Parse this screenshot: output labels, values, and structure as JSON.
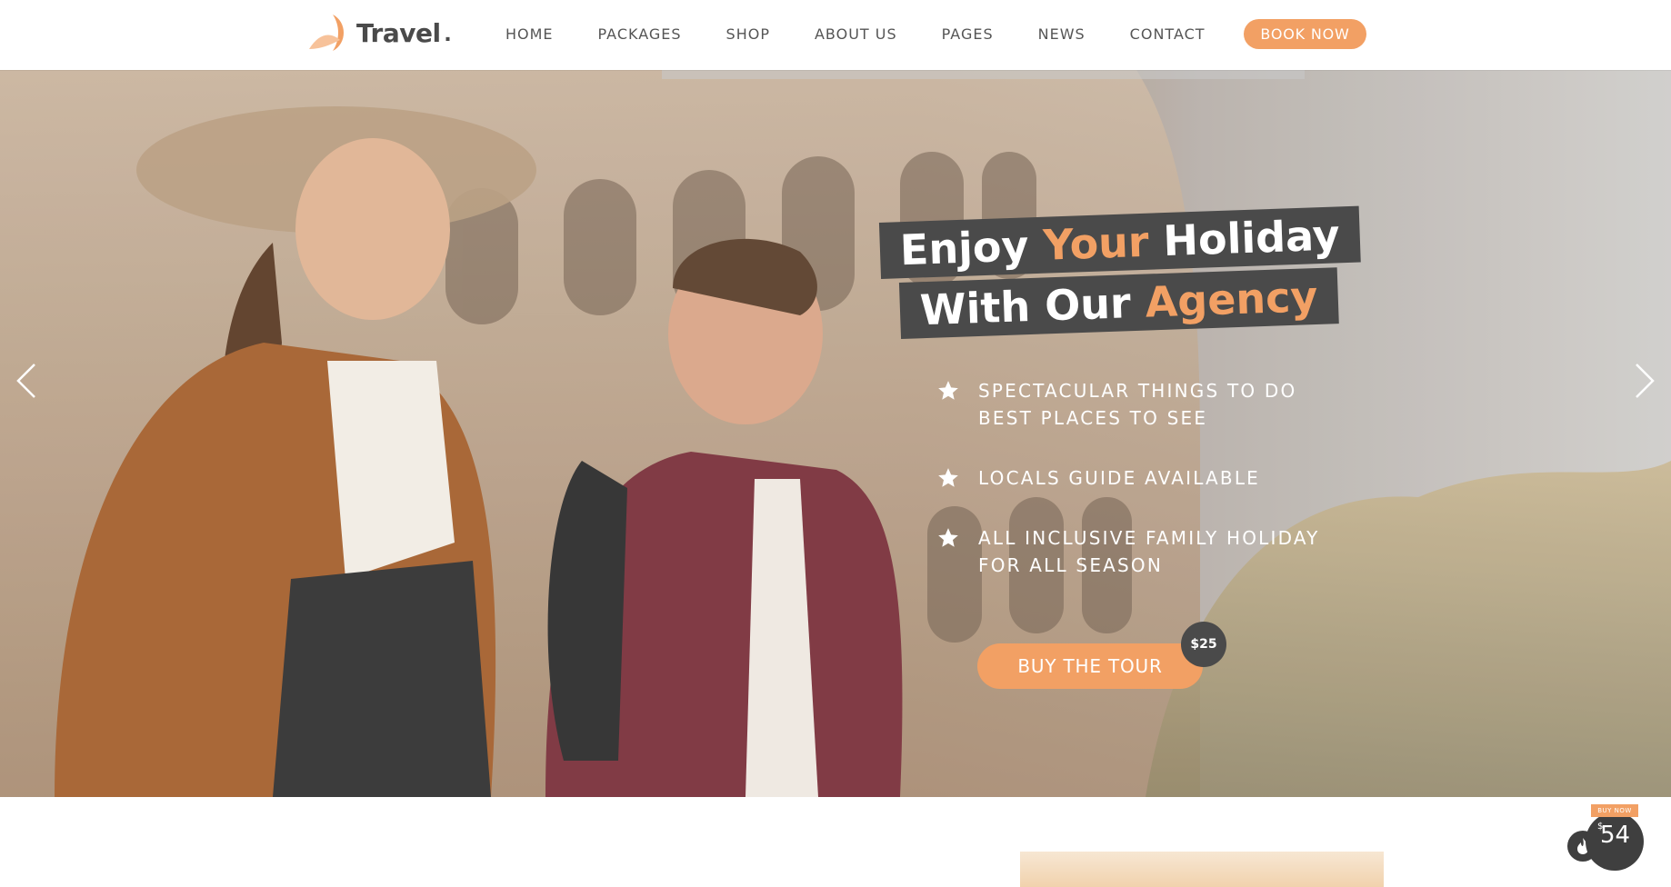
{
  "brand": {
    "name": "Travel",
    "dot": ".",
    "accent": "#f2a064",
    "dark": "#4a4a4a"
  },
  "nav": {
    "items": [
      {
        "label": "HOME"
      },
      {
        "label": "PACKAGES"
      },
      {
        "label": "SHOP"
      },
      {
        "label": "ABOUT US"
      },
      {
        "label": "PAGES"
      },
      {
        "label": "NEWS"
      },
      {
        "label": "CONTACT"
      }
    ],
    "cta": "BOOK NOW"
  },
  "hero": {
    "headline_line1": {
      "a": "Enjoy ",
      "accent": "Your",
      "b": " Holiday"
    },
    "headline_line2": {
      "a": "With Our ",
      "accent": "Agency"
    },
    "features": [
      {
        "line1": "SPECTACULAR THINGS TO DO",
        "line2": "BEST PLACES TO SEE",
        "icon": "star-icon"
      },
      {
        "line1": "LOCALS GUIDE AVAILABLE",
        "line2": "",
        "icon": "star-icon"
      },
      {
        "line1": "ALL INCLUSIVE FAMILY HOLIDAY",
        "line2": "FOR ALL SEASON",
        "icon": "star-icon"
      }
    ],
    "cta": "BUY THE TOUR",
    "price": "$25",
    "prev_icon": "chevron-left-icon",
    "next_icon": "chevron-right-icon"
  },
  "buy_widget": {
    "label": "BUY NOW",
    "currency": "$",
    "price": "54"
  }
}
